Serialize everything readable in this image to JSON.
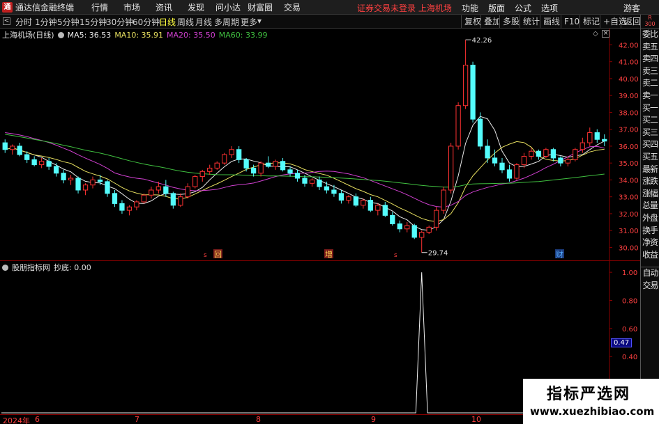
{
  "app": {
    "title": "通达信金融终端",
    "logo": "tdx-logo-icon"
  },
  "menu": {
    "left": [
      "行情",
      "市场",
      "资讯",
      "发现",
      "问小达",
      "财富圈",
      "交易"
    ],
    "notice": "证券交易未登录  上海机场",
    "right": [
      "功能",
      "版面",
      "公式",
      "选项"
    ],
    "guest": "游客"
  },
  "toolbar": {
    "periods": [
      "分时",
      "1分钟",
      "5分钟",
      "15分钟",
      "30分钟",
      "60分钟",
      "日线",
      "周线",
      "月线",
      "多周期",
      "更多"
    ],
    "active": "日线",
    "right_buttons": [
      "复权",
      "叠加",
      "多股",
      "统计",
      "画线",
      "F10",
      "标记",
      "+自选",
      "返回"
    ]
  },
  "main_legend": {
    "name": "上海机场(日线)",
    "ma5": "MA5: 36.53",
    "ma10": "MA10: 35.91",
    "ma20": "MA20: 35.50",
    "ma60": "MA60: 33.99"
  },
  "sub_legend": {
    "name": "股朋指标网",
    "value": "抄底: 0.00"
  },
  "annotations": {
    "high": "42.26",
    "low": "29.74",
    "markers": [
      "回",
      "增",
      "财"
    ]
  },
  "side_panel": {
    "top": [
      "R",
      "300"
    ],
    "items": [
      "委比",
      "卖五",
      "卖四",
      "卖三",
      "卖二",
      "卖一",
      "买一",
      "买二",
      "买三",
      "买四",
      "买五",
      "最新",
      "涨跌",
      "涨幅",
      "总量",
      "外盘",
      "换手",
      "净资",
      "收益"
    ],
    "group2": [
      "自动",
      "交易"
    ]
  },
  "x_axis": [
    "2024年",
    "6",
    "7",
    "8",
    "9",
    "10"
  ],
  "current_value": "0.47",
  "watermark": {
    "title": "指标严选网",
    "url": "www.xuezhibiao.com"
  },
  "chart_data": [
    {
      "type": "candlestick",
      "title": "上海机场(日线)",
      "y_ticks": [
        42.0,
        41.0,
        40.0,
        39.0,
        38.0,
        37.0,
        36.0,
        35.0,
        34.0,
        33.0,
        32.0,
        31.0,
        30.0
      ],
      "ylim": [
        29.4,
        42.8
      ],
      "ohlc": [
        [
          36.2,
          36.4,
          35.6,
          35.8
        ],
        [
          35.8,
          36.1,
          35.5,
          36.0
        ],
        [
          36.0,
          36.2,
          35.4,
          35.5
        ],
        [
          35.5,
          35.7,
          35.0,
          35.2
        ],
        [
          35.2,
          35.4,
          34.8,
          34.9
        ],
        [
          34.9,
          35.3,
          34.7,
          35.1
        ],
        [
          35.1,
          35.3,
          34.6,
          34.8
        ],
        [
          34.8,
          35.0,
          34.2,
          34.4
        ],
        [
          34.4,
          34.6,
          33.8,
          34.0
        ],
        [
          34.0,
          34.3,
          33.7,
          34.1
        ],
        [
          34.1,
          34.2,
          33.2,
          33.4
        ],
        [
          33.4,
          33.8,
          33.1,
          33.7
        ],
        [
          33.7,
          34.2,
          33.5,
          34.0
        ],
        [
          34.0,
          34.3,
          33.7,
          33.9
        ],
        [
          33.9,
          34.0,
          33.0,
          33.2
        ],
        [
          33.2,
          33.4,
          32.4,
          32.6
        ],
        [
          32.6,
          32.8,
          32.0,
          32.2
        ],
        [
          32.2,
          32.5,
          31.9,
          32.4
        ],
        [
          32.4,
          32.8,
          32.2,
          32.7
        ],
        [
          32.7,
          33.2,
          32.6,
          33.1
        ],
        [
          33.1,
          33.6,
          32.9,
          33.4
        ],
        [
          33.4,
          33.9,
          33.2,
          33.6
        ],
        [
          33.6,
          34.0,
          33.0,
          33.2
        ],
        [
          33.2,
          33.3,
          32.3,
          32.5
        ],
        [
          32.5,
          33.2,
          32.4,
          33.0
        ],
        [
          33.0,
          33.8,
          32.9,
          33.6
        ],
        [
          33.6,
          34.3,
          33.5,
          34.2
        ],
        [
          34.2,
          34.6,
          33.9,
          34.5
        ],
        [
          34.5,
          34.9,
          34.3,
          34.7
        ],
        [
          34.7,
          35.1,
          34.6,
          35.0
        ],
        [
          35.0,
          35.6,
          34.9,
          35.5
        ],
        [
          35.5,
          36.0,
          35.3,
          35.8
        ],
        [
          35.8,
          36.0,
          35.0,
          35.2
        ],
        [
          35.2,
          35.3,
          34.5,
          34.7
        ],
        [
          34.7,
          34.9,
          34.2,
          34.4
        ],
        [
          34.4,
          35.1,
          34.2,
          35.0
        ],
        [
          35.0,
          35.4,
          34.7,
          34.8
        ],
        [
          34.8,
          35.2,
          34.6,
          35.1
        ],
        [
          35.1,
          35.3,
          34.5,
          34.6
        ],
        [
          34.6,
          34.8,
          34.2,
          34.4
        ],
        [
          34.4,
          34.6,
          33.9,
          34.1
        ],
        [
          34.1,
          34.3,
          33.6,
          33.8
        ],
        [
          33.8,
          34.1,
          33.6,
          34.0
        ],
        [
          34.0,
          34.2,
          33.4,
          33.6
        ],
        [
          33.6,
          33.9,
          33.2,
          33.4
        ],
        [
          33.4,
          33.7,
          33.0,
          33.2
        ],
        [
          33.2,
          33.4,
          32.6,
          32.8
        ],
        [
          32.8,
          33.1,
          32.6,
          33.0
        ],
        [
          33.0,
          33.2,
          32.4,
          32.5
        ],
        [
          32.5,
          32.9,
          32.3,
          32.8
        ],
        [
          32.8,
          33.0,
          32.1,
          32.2
        ],
        [
          32.2,
          32.6,
          31.9,
          32.5
        ],
        [
          32.5,
          32.7,
          31.8,
          31.9
        ],
        [
          31.9,
          32.1,
          31.3,
          31.4
        ],
        [
          31.4,
          31.6,
          30.9,
          31.1
        ],
        [
          31.1,
          31.5,
          30.9,
          31.3
        ],
        [
          31.3,
          31.4,
          30.5,
          30.6
        ],
        [
          30.6,
          31.0,
          29.7,
          30.9
        ],
        [
          30.9,
          31.3,
          30.8,
          31.2
        ],
        [
          31.2,
          32.4,
          31.0,
          32.2
        ],
        [
          32.2,
          33.6,
          32.0,
          33.4
        ],
        [
          33.4,
          36.2,
          33.2,
          36.0
        ],
        [
          36.0,
          38.6,
          35.8,
          38.4
        ],
        [
          38.4,
          42.3,
          38.2,
          40.8
        ],
        [
          40.8,
          41.0,
          37.4,
          37.6
        ],
        [
          37.6,
          38.0,
          35.8,
          36.0
        ],
        [
          36.0,
          36.4,
          35.0,
          35.3
        ],
        [
          35.3,
          35.8,
          34.8,
          35.0
        ],
        [
          35.0,
          35.3,
          34.4,
          34.6
        ],
        [
          34.6,
          34.9,
          33.9,
          34.1
        ],
        [
          34.1,
          35.0,
          34.0,
          34.9
        ],
        [
          34.9,
          35.6,
          34.7,
          35.4
        ],
        [
          35.4,
          35.9,
          35.2,
          35.7
        ],
        [
          35.7,
          35.8,
          35.2,
          35.4
        ],
        [
          35.4,
          35.9,
          35.3,
          35.8
        ],
        [
          35.8,
          35.9,
          35.1,
          35.3
        ],
        [
          35.3,
          35.4,
          34.8,
          35.0
        ],
        [
          35.0,
          35.4,
          34.8,
          35.2
        ],
        [
          35.2,
          35.9,
          35.1,
          35.8
        ],
        [
          35.8,
          36.5,
          35.6,
          36.2
        ],
        [
          36.2,
          37.1,
          36.0,
          36.8
        ],
        [
          36.8,
          37.0,
          36.2,
          36.4
        ],
        [
          36.4,
          36.7,
          36.0,
          36.3
        ]
      ],
      "ma_labels": [
        "MA5",
        "MA10",
        "MA20",
        "MA60"
      ],
      "ma_colors": [
        "#e8e8e8",
        "#e8e060",
        "#d040d0",
        "#40c040"
      ]
    },
    {
      "type": "line",
      "title": "抄底",
      "y_ticks": [
        1.0,
        0.8,
        0.6,
        0.4
      ],
      "ylim": [
        0.0,
        1.06
      ],
      "spike_index": 57,
      "values_note": "0 everywhere, 1.0 at spike_index"
    }
  ],
  "colors": {
    "up": "#ff3232",
    "down": "#54fcfc",
    "axis": "#8b0000",
    "tick_text": "#ff4040"
  }
}
